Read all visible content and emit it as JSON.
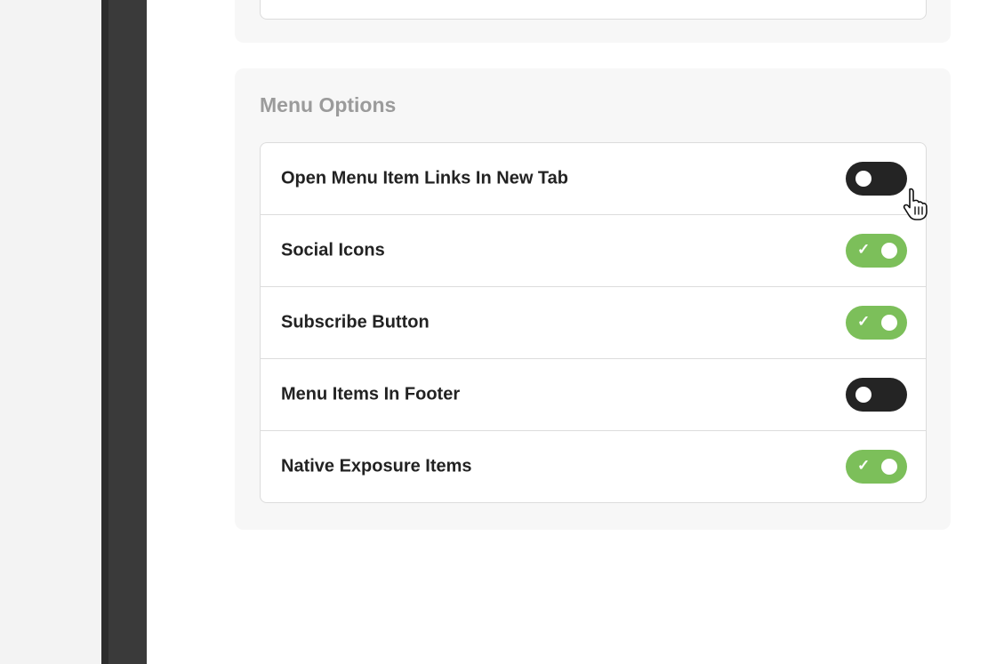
{
  "menu_options": {
    "title": "Menu Options",
    "items": [
      {
        "label": "Open Menu Item Links In New Tab",
        "enabled": false
      },
      {
        "label": "Social Icons",
        "enabled": true
      },
      {
        "label": "Subscribe Button",
        "enabled": true
      },
      {
        "label": "Menu Items In Footer",
        "enabled": false
      },
      {
        "label": "Native Exposure Items",
        "enabled": true
      }
    ]
  },
  "icons": {
    "check": "check-icon",
    "cursor": "hand-pointer-icon"
  },
  "colors": {
    "toggle_on": "#7cbf5a",
    "toggle_off": "#242424",
    "section_title": "#9b9b9b",
    "label": "#222222"
  }
}
